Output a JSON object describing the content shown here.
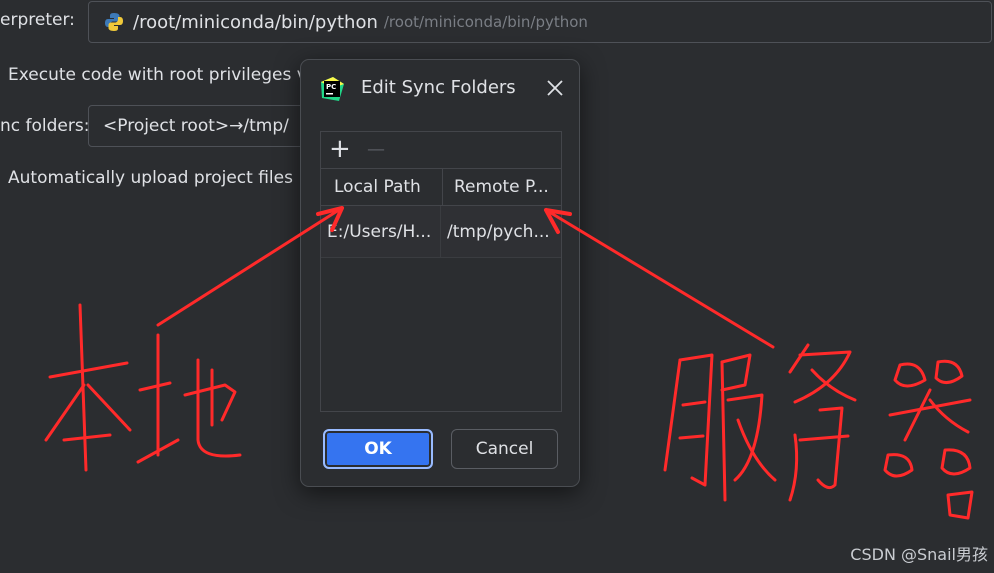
{
  "settings": {
    "interpreter_label": "erpreter:",
    "interpreter_path": "/root/miniconda/bin/python",
    "interpreter_path_hint": "/root/miniconda/bin/python",
    "root_privileges_label": "Execute code with root privileges v",
    "sync_folders_label": "nc folders:",
    "sync_folders_value": "<Project root>→/tmp/",
    "auto_upload_label": "Automatically upload project files"
  },
  "dialog": {
    "title": "Edit Sync Folders",
    "add_button": "+",
    "remove_button": "—",
    "columns": [
      "Local Path",
      "Remote P..."
    ],
    "rows": [
      [
        "E:/Users/H...",
        "/tmp/pych..."
      ]
    ],
    "ok_label": "OK",
    "cancel_label": "Cancel"
  },
  "annotations": {
    "local_text": "本地",
    "server_text": "服务器",
    "color": "#ff2a2a"
  },
  "watermark": "CSDN @Snail男孩",
  "colors": {
    "background": "#2b2d30",
    "accent": "#3574f0",
    "annotation": "#ff2a2a"
  }
}
